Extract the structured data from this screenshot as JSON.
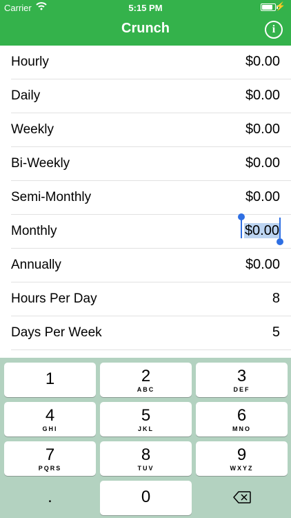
{
  "status": {
    "carrier": "Carrier",
    "time": "5:15 PM",
    "battery_level": 0.85
  },
  "nav": {
    "title": "Crunch",
    "info_glyph": "i"
  },
  "rows": [
    {
      "label": "Hourly",
      "value": "$0.00"
    },
    {
      "label": "Daily",
      "value": "$0.00"
    },
    {
      "label": "Weekly",
      "value": "$0.00"
    },
    {
      "label": "Bi-Weekly",
      "value": "$0.00"
    },
    {
      "label": "Semi-Monthly",
      "value": "$0.00"
    },
    {
      "label": "Monthly",
      "value": "$0.00",
      "selected": true
    },
    {
      "label": "Annually",
      "value": "$0.00"
    },
    {
      "label": "Hours Per Day",
      "value": "8"
    },
    {
      "label": "Days Per Week",
      "value": "5"
    }
  ],
  "keyboard": {
    "keys": [
      {
        "digit": "1",
        "letters": ""
      },
      {
        "digit": "2",
        "letters": "ABC"
      },
      {
        "digit": "3",
        "letters": "DEF"
      },
      {
        "digit": "4",
        "letters": "GHI"
      },
      {
        "digit": "5",
        "letters": "JKL"
      },
      {
        "digit": "6",
        "letters": "MNO"
      },
      {
        "digit": "7",
        "letters": "PQRS"
      },
      {
        "digit": "8",
        "letters": "TUV"
      },
      {
        "digit": "9",
        "letters": "WXYZ"
      }
    ],
    "decimal": ".",
    "zero": "0",
    "delete_icon": "backspace-icon"
  },
  "colors": {
    "header": "#34b24b",
    "keyboard_bg": "#b3d2c0",
    "selection": "#bcd4f1",
    "handle": "#2e6fe3"
  }
}
